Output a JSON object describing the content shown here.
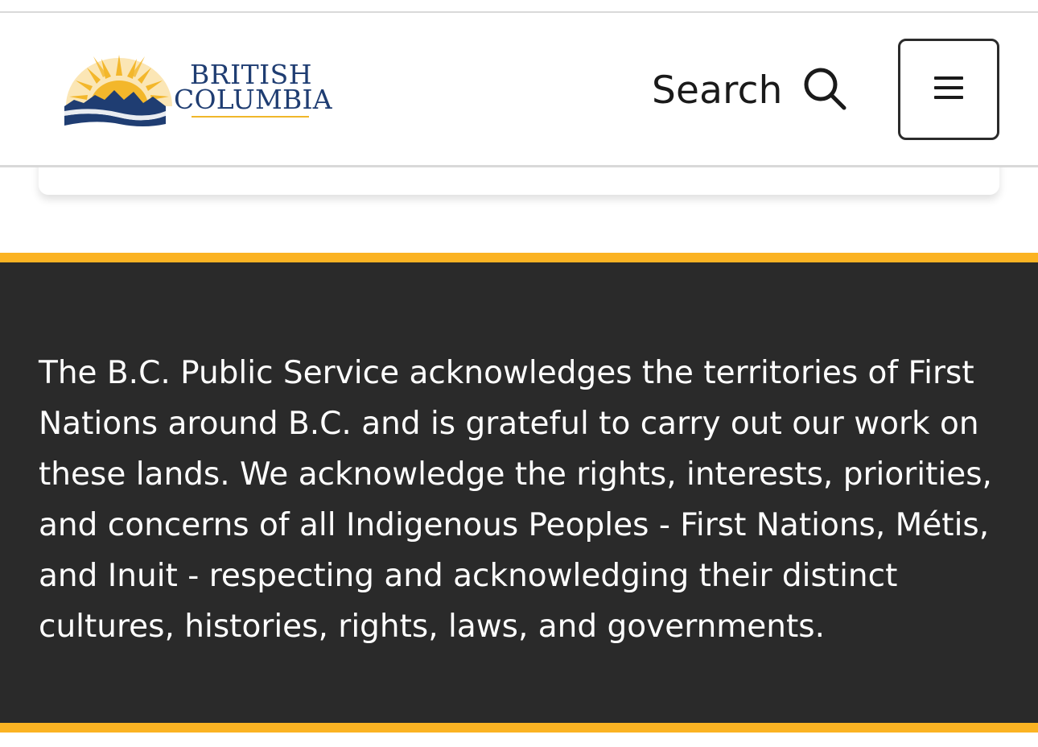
{
  "header": {
    "logo": {
      "line1": "BRITISH",
      "line2": "COLUMBIA",
      "icon": "bc-sun-mountains-logo",
      "colors": {
        "sun": "#f3b72b",
        "mountains": "#1f3d72"
      }
    },
    "search": {
      "label": "Search",
      "icon": "search-icon"
    },
    "menu": {
      "icon": "hamburger-menu-icon"
    }
  },
  "acknowledgement": {
    "text": "The B.C. Public Service acknowledges the territories of First Nations around B.C. and is grateful to carry out our work on these lands. We acknowledge the rights, interests, priorities, and concerns of all Indigenous Peoples - First Nations, Métis, and Inuit - respecting and acknowledging their distinct cultures, histories, rights, laws, and governments."
  },
  "colors": {
    "accent": "#fbb323",
    "footer_background": "#2a2a2a",
    "text_dark": "#1a1a1a"
  }
}
